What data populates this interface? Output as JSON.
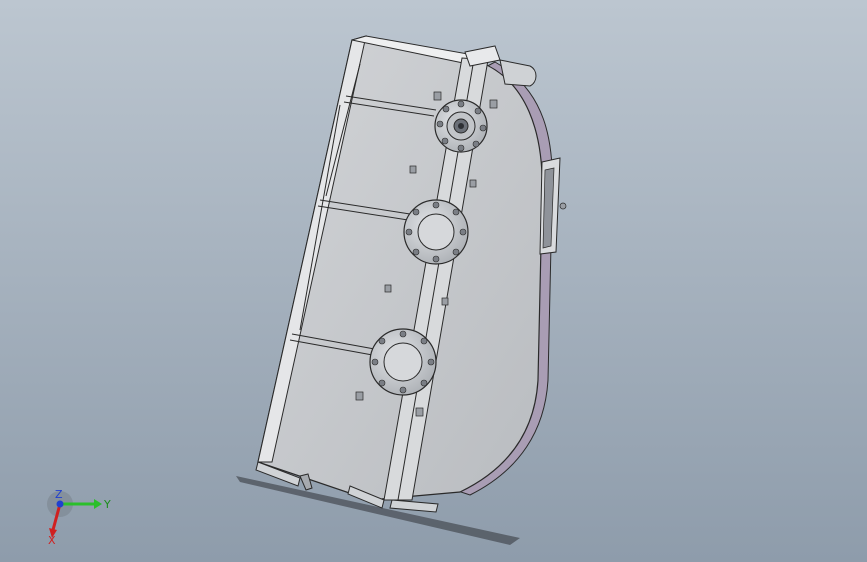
{
  "viewport": {
    "background_top": "#b9c4ce",
    "background_bottom": "#8f9dac"
  },
  "model": {
    "name": "gearbox-housing",
    "body_fill": "#c9ccd0",
    "edge_color": "#2a2a2a",
    "side_fill": "#a79bb0",
    "flanges_count": 3
  },
  "triad": {
    "x_label": "X",
    "y_label": "Y",
    "z_label": "Z",
    "x_color": "#d02020",
    "y_color": "#2bbf2b",
    "z_color": "#2040d0"
  }
}
